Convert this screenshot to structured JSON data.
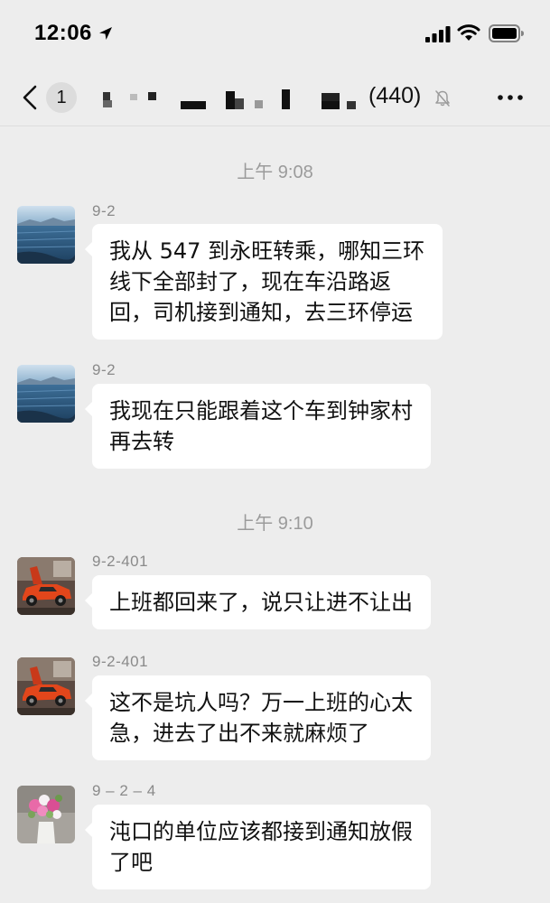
{
  "status_bar": {
    "time": "12:06",
    "location_icon": "location-arrow-icon",
    "signal_icon": "cellular-signal-icon",
    "wifi_icon": "wifi-icon",
    "battery_icon": "battery-icon"
  },
  "nav": {
    "back_icon": "chevron-left-icon",
    "unread_count": "1",
    "group_name": "",
    "member_count": "(440)",
    "mute_icon": "bell-muted-icon",
    "more_icon": "more-dots-icon"
  },
  "timestamps": [
    "上午 9:08",
    "上午 9:10"
  ],
  "messages": [
    {
      "sender": "9-2",
      "avatar": "lake-photo-avatar",
      "text": "我从 547 到永旺转乘，哪知三环\n线下全部封了，现在车沿路返\n回，司机接到通知，去三环停运"
    },
    {
      "sender": "9-2",
      "avatar": "lake-photo-avatar",
      "text": "我现在只能跟着这个车到钟家村\n再去转"
    },
    {
      "sender": "9-2-401",
      "avatar": "red-sports-car-avatar",
      "text": "上班都回来了，说只让进不让出"
    },
    {
      "sender": "9-2-401",
      "avatar": "red-sports-car-avatar",
      "text": "这不是坑人吗？万一上班的心太\n急，进去了出不来就麻烦了"
    },
    {
      "sender": "9 – 2 – 4",
      "avatar": "flower-vase-avatar",
      "text": "沌口的单位应该都接到通知放假\n了吧"
    }
  ],
  "colors": {
    "background": "#ededed",
    "bubble": "#ffffff",
    "timestamp_text": "#9b9b9b",
    "sender_text": "#8a8a8a"
  }
}
